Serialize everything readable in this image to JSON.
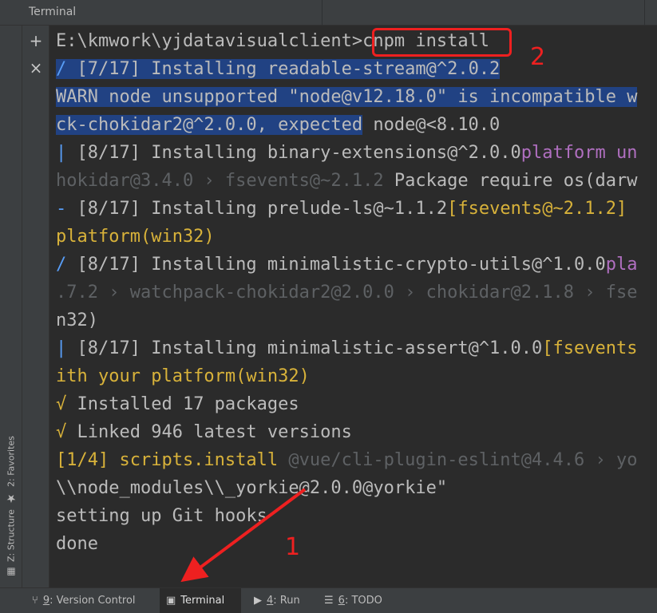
{
  "window": {
    "title": "Terminal"
  },
  "left_tabs": {
    "favorites": "2: Favorites",
    "structure": "Z: Structure"
  },
  "tool_strip": {
    "new_session": "+",
    "close_session": "×"
  },
  "terminal": {
    "lines": [
      {
        "segs": [
          {
            "t": "E:\\kmwork\\yjdatavisualclient>",
            "c": "default"
          },
          {
            "t": "cnpm install",
            "c": "default"
          }
        ]
      },
      {
        "segs": [
          {
            "t": "/ ",
            "c": "blue",
            "sel": true
          },
          {
            "t": "[7/17] Installing readable-stream@^2.0.2",
            "c": "default",
            "sel": true
          }
        ]
      },
      {
        "segs": [
          {
            "t": "WARN node unsupported \"node@v12.18.0\" is incompatible w",
            "c": "default",
            "sel": true
          }
        ]
      },
      {
        "segs": [
          {
            "t": "ck-chokidar2@^2.0.0, expected",
            "c": "default",
            "sel": true
          },
          {
            "t": " node@<8.10.0",
            "c": "default"
          }
        ]
      },
      {
        "segs": [
          {
            "t": "| ",
            "c": "blue"
          },
          {
            "t": "[8/17] Installing binary-extensions@^2.0.0",
            "c": "default"
          },
          {
            "t": "platform un",
            "c": "magenta"
          }
        ]
      },
      {
        "segs": [
          {
            "t": "hokidar@3.4.0 › fsevents@~2.1.2",
            "c": "gray"
          },
          {
            "t": " Package require os(darw",
            "c": "default"
          }
        ]
      },
      {
        "segs": [
          {
            "t": "- ",
            "c": "blue"
          },
          {
            "t": "[8/17] Installing prelude-ls@~1.1.2",
            "c": "default"
          },
          {
            "t": "[fsevents@~2.1.2]",
            "c": "yellow"
          }
        ]
      },
      {
        "segs": [
          {
            "t": "platform(win32)",
            "c": "yellow"
          }
        ]
      },
      {
        "segs": [
          {
            "t": "/ ",
            "c": "blue"
          },
          {
            "t": "[8/17] Installing minimalistic-crypto-utils@^1.0.0",
            "c": "default"
          },
          {
            "t": "pla",
            "c": "magenta"
          }
        ]
      },
      {
        "segs": [
          {
            "t": ".7.2 › watchpack-chokidar2@2.0.0 › chokidar@2.1.8 › fse",
            "c": "gray"
          }
        ]
      },
      {
        "segs": [
          {
            "t": "n32)",
            "c": "default"
          }
        ]
      },
      {
        "segs": [
          {
            "t": "| ",
            "c": "blue"
          },
          {
            "t": "[8/17] Installing minimalistic-assert@^1.0.0",
            "c": "default"
          },
          {
            "t": "[fsevents",
            "c": "yellow"
          }
        ]
      },
      {
        "segs": [
          {
            "t": "ith your platform(win32)",
            "c": "yellow"
          }
        ]
      },
      {
        "segs": [
          {
            "t": "√ ",
            "c": "green"
          },
          {
            "t": "Installed 17 packages",
            "c": "default"
          }
        ]
      },
      {
        "segs": [
          {
            "t": "√ ",
            "c": "green"
          },
          {
            "t": "Linked 946 latest versions",
            "c": "default"
          }
        ]
      },
      {
        "segs": [
          {
            "t": "[1/4] scripts.install",
            "c": "yellow"
          },
          {
            "t": " @vue/cli-plugin-eslint@4.4.6 › yo",
            "c": "gray"
          }
        ]
      },
      {
        "segs": [
          {
            "t": "\\\\node_modules\\\\_yorkie@2.0.0@yorkie\"",
            "c": "default"
          }
        ]
      },
      {
        "segs": [
          {
            "t": "setting up Git hooks",
            "c": "default"
          }
        ]
      },
      {
        "segs": [
          {
            "t": "done",
            "c": "default"
          }
        ]
      }
    ]
  },
  "annotations": {
    "label_1": "1",
    "label_2": "2"
  },
  "bottom_tabs": [
    {
      "key": "9",
      "label": ": Version Control",
      "icon": "branch-icon"
    },
    {
      "key": "",
      "label": "Terminal",
      "icon": "terminal-icon"
    },
    {
      "key": "4",
      "label": ": Run",
      "icon": "run-icon"
    },
    {
      "key": "6",
      "label": ": TODO",
      "icon": "todo-icon"
    }
  ],
  "colors": {
    "selection": "#214283",
    "annotation_red": "#ee2020",
    "prompt_blue": "#589df6",
    "warn_yellow": "#d8b23a",
    "platform_magenta": "#b06fc0",
    "dim_gray": "#5e6164"
  }
}
